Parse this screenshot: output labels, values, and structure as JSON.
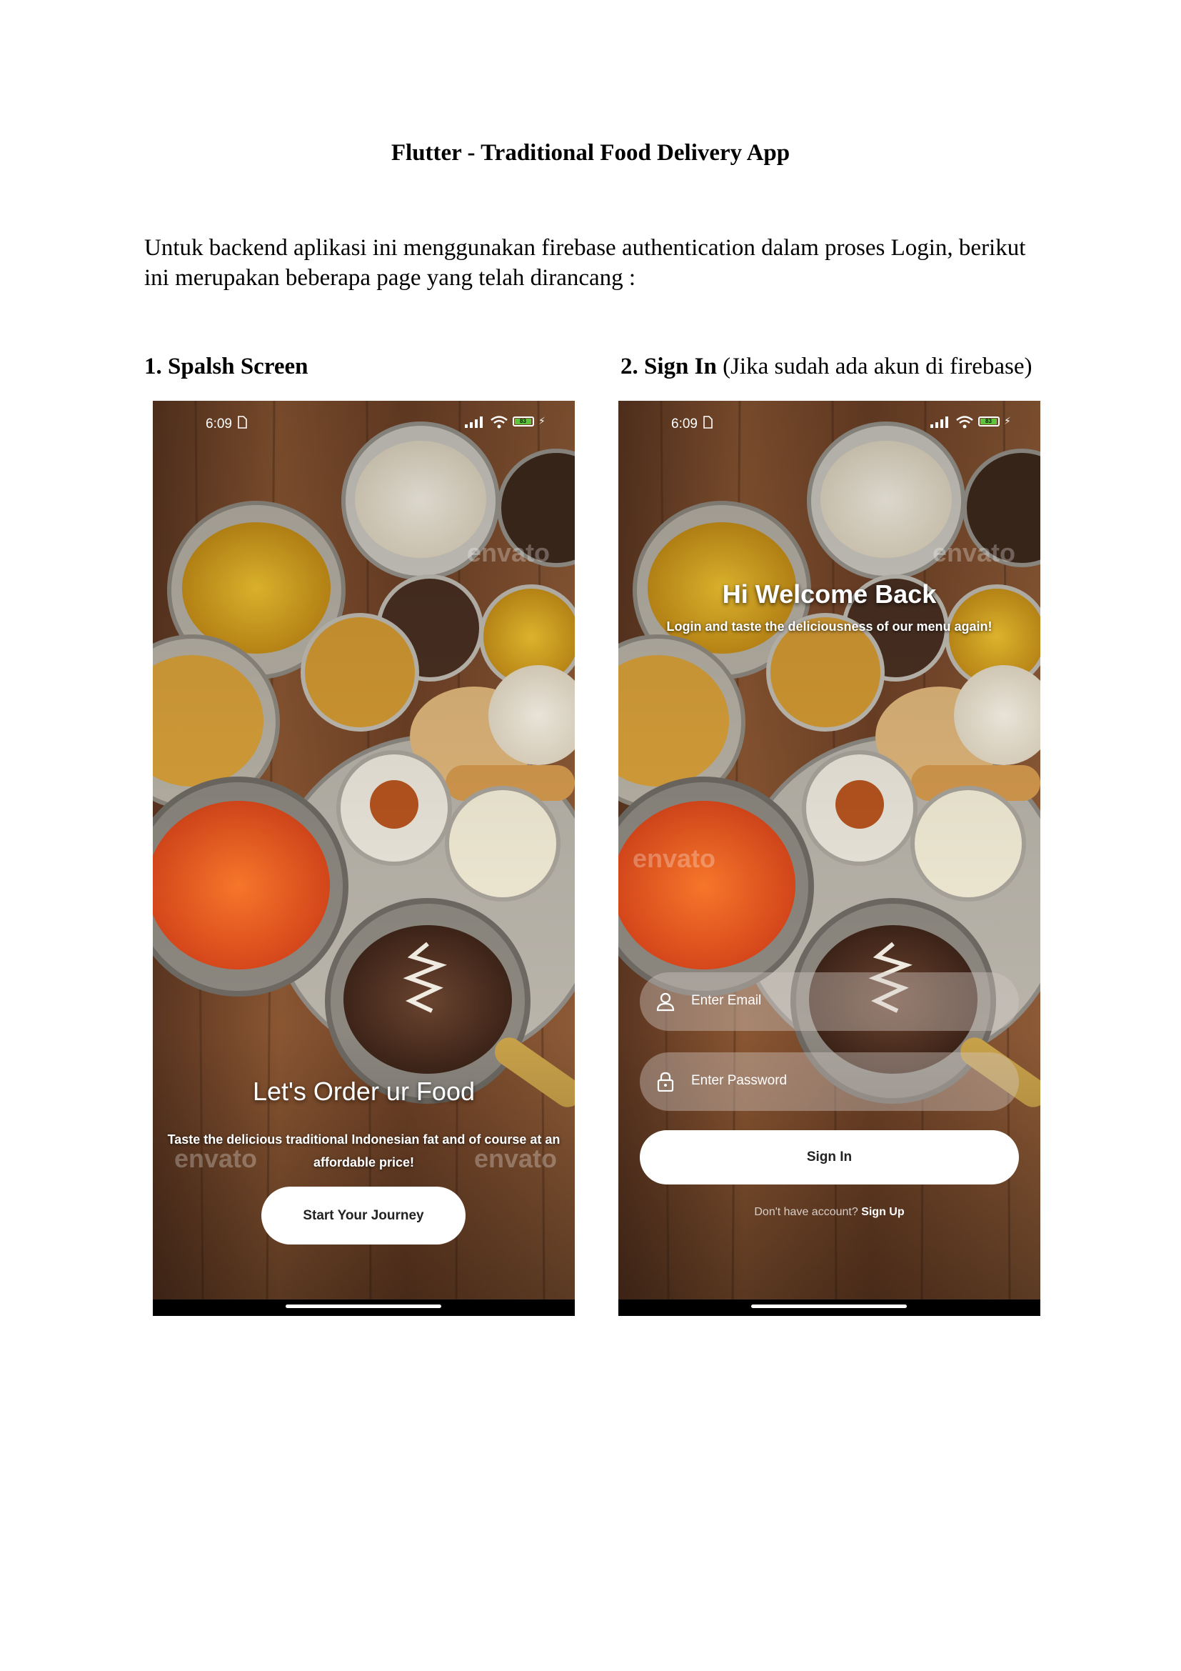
{
  "document": {
    "title": "Flutter - Traditional Food Delivery App",
    "intro": "Untuk backend aplikasi ini menggunakan firebase authentication dalam proses Login, berikut ini merupakan beberapa page yang telah dirancang :",
    "section1": {
      "heading": "1. Spalsh Screen"
    },
    "section2": {
      "heading": "2. Sign In",
      "note": " (Jika sudah ada akun di firebase)"
    }
  },
  "status_bar": {
    "time": "6:09",
    "battery": "83"
  },
  "watermark": "envato",
  "splash": {
    "title": "Let's Order ur Food",
    "subtitle": "Taste the delicious traditional Indonesian fat and of course at an affordable price!",
    "button": "Start Your Journey"
  },
  "signin": {
    "title": "Hi Welcome Back",
    "subtitle": "Login and taste the deliciousness of our menu again!",
    "email_placeholder": "Enter Email",
    "password_placeholder": "Enter Password",
    "button": "Sign In",
    "prompt": "Don't have account? ",
    "signup_link": "Sign Up"
  },
  "icons": [
    "sim-icon",
    "signal-icon",
    "wifi-icon",
    "battery-icon",
    "charging-icon",
    "user-icon",
    "lock-icon"
  ],
  "colors": {
    "button_bg": "#ffffff",
    "battery_fill": "#5ec43b",
    "wood": "#7a4a2a"
  }
}
